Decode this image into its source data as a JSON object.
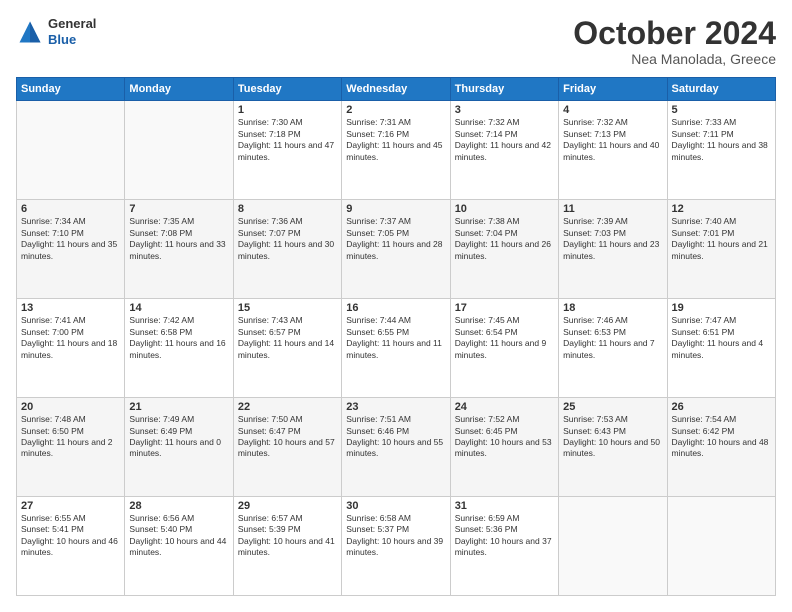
{
  "header": {
    "logo": {
      "general": "General",
      "blue": "Blue"
    },
    "title": "October 2024",
    "location": "Nea Manolada, Greece"
  },
  "calendar": {
    "days_of_week": [
      "Sunday",
      "Monday",
      "Tuesday",
      "Wednesday",
      "Thursday",
      "Friday",
      "Saturday"
    ],
    "weeks": [
      {
        "days": [
          {
            "empty": true
          },
          {
            "empty": true
          },
          {
            "date": "1",
            "sunrise": "7:30 AM",
            "sunset": "7:18 PM",
            "daylight": "11 hours and 47 minutes."
          },
          {
            "date": "2",
            "sunrise": "7:31 AM",
            "sunset": "7:16 PM",
            "daylight": "11 hours and 45 minutes."
          },
          {
            "date": "3",
            "sunrise": "7:32 AM",
            "sunset": "7:14 PM",
            "daylight": "11 hours and 42 minutes."
          },
          {
            "date": "4",
            "sunrise": "7:32 AM",
            "sunset": "7:13 PM",
            "daylight": "11 hours and 40 minutes."
          },
          {
            "date": "5",
            "sunrise": "7:33 AM",
            "sunset": "7:11 PM",
            "daylight": "11 hours and 38 minutes."
          }
        ]
      },
      {
        "alt": true,
        "days": [
          {
            "date": "6",
            "sunrise": "7:34 AM",
            "sunset": "7:10 PM",
            "daylight": "11 hours and 35 minutes."
          },
          {
            "date": "7",
            "sunrise": "7:35 AM",
            "sunset": "7:08 PM",
            "daylight": "11 hours and 33 minutes."
          },
          {
            "date": "8",
            "sunrise": "7:36 AM",
            "sunset": "7:07 PM",
            "daylight": "11 hours and 30 minutes."
          },
          {
            "date": "9",
            "sunrise": "7:37 AM",
            "sunset": "7:05 PM",
            "daylight": "11 hours and 28 minutes."
          },
          {
            "date": "10",
            "sunrise": "7:38 AM",
            "sunset": "7:04 PM",
            "daylight": "11 hours and 26 minutes."
          },
          {
            "date": "11",
            "sunrise": "7:39 AM",
            "sunset": "7:03 PM",
            "daylight": "11 hours and 23 minutes."
          },
          {
            "date": "12",
            "sunrise": "7:40 AM",
            "sunset": "7:01 PM",
            "daylight": "11 hours and 21 minutes."
          }
        ]
      },
      {
        "days": [
          {
            "date": "13",
            "sunrise": "7:41 AM",
            "sunset": "7:00 PM",
            "daylight": "11 hours and 18 minutes."
          },
          {
            "date": "14",
            "sunrise": "7:42 AM",
            "sunset": "6:58 PM",
            "daylight": "11 hours and 16 minutes."
          },
          {
            "date": "15",
            "sunrise": "7:43 AM",
            "sunset": "6:57 PM",
            "daylight": "11 hours and 14 minutes."
          },
          {
            "date": "16",
            "sunrise": "7:44 AM",
            "sunset": "6:55 PM",
            "daylight": "11 hours and 11 minutes."
          },
          {
            "date": "17",
            "sunrise": "7:45 AM",
            "sunset": "6:54 PM",
            "daylight": "11 hours and 9 minutes."
          },
          {
            "date": "18",
            "sunrise": "7:46 AM",
            "sunset": "6:53 PM",
            "daylight": "11 hours and 7 minutes."
          },
          {
            "date": "19",
            "sunrise": "7:47 AM",
            "sunset": "6:51 PM",
            "daylight": "11 hours and 4 minutes."
          }
        ]
      },
      {
        "alt": true,
        "days": [
          {
            "date": "20",
            "sunrise": "7:48 AM",
            "sunset": "6:50 PM",
            "daylight": "11 hours and 2 minutes."
          },
          {
            "date": "21",
            "sunrise": "7:49 AM",
            "sunset": "6:49 PM",
            "daylight": "11 hours and 0 minutes."
          },
          {
            "date": "22",
            "sunrise": "7:50 AM",
            "sunset": "6:47 PM",
            "daylight": "10 hours and 57 minutes."
          },
          {
            "date": "23",
            "sunrise": "7:51 AM",
            "sunset": "6:46 PM",
            "daylight": "10 hours and 55 minutes."
          },
          {
            "date": "24",
            "sunrise": "7:52 AM",
            "sunset": "6:45 PM",
            "daylight": "10 hours and 53 minutes."
          },
          {
            "date": "25",
            "sunrise": "7:53 AM",
            "sunset": "6:43 PM",
            "daylight": "10 hours and 50 minutes."
          },
          {
            "date": "26",
            "sunrise": "7:54 AM",
            "sunset": "6:42 PM",
            "daylight": "10 hours and 48 minutes."
          }
        ]
      },
      {
        "days": [
          {
            "date": "27",
            "sunrise": "6:55 AM",
            "sunset": "5:41 PM",
            "daylight": "10 hours and 46 minutes."
          },
          {
            "date": "28",
            "sunrise": "6:56 AM",
            "sunset": "5:40 PM",
            "daylight": "10 hours and 44 minutes."
          },
          {
            "date": "29",
            "sunrise": "6:57 AM",
            "sunset": "5:39 PM",
            "daylight": "10 hours and 41 minutes."
          },
          {
            "date": "30",
            "sunrise": "6:58 AM",
            "sunset": "5:37 PM",
            "daylight": "10 hours and 39 minutes."
          },
          {
            "date": "31",
            "sunrise": "6:59 AM",
            "sunset": "5:36 PM",
            "daylight": "10 hours and 37 minutes."
          },
          {
            "empty": true
          },
          {
            "empty": true
          }
        ]
      }
    ]
  }
}
